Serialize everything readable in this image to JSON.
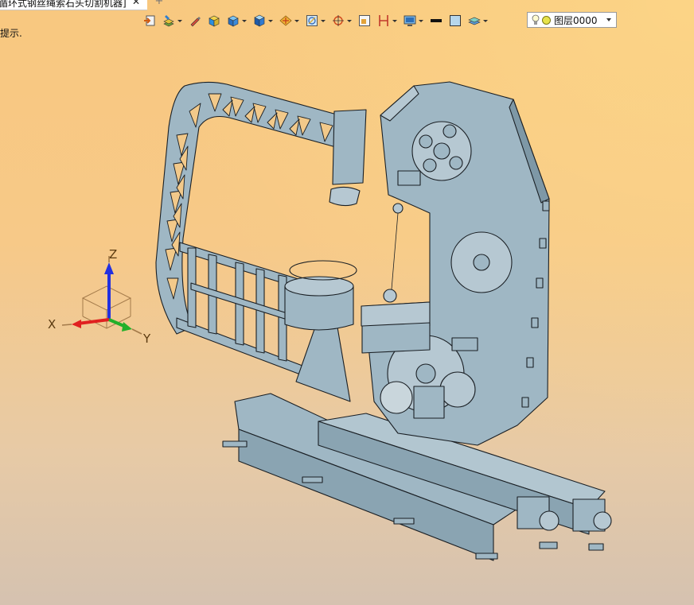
{
  "tab": {
    "title": "循环式钢丝绳索石头切割机器]",
    "close_glyph": "✕",
    "new_glyph": "+"
  },
  "hint": "提示.",
  "toolbar": {
    "items": [
      {
        "name": "import-icon"
      },
      {
        "name": "paint-layers-icon",
        "dropdown": true
      },
      {
        "name": "pen-icon"
      },
      {
        "name": "yellow-box-icon"
      },
      {
        "name": "blue-box-icon",
        "dropdown": true
      },
      {
        "name": "box-view-icon",
        "dropdown": true
      },
      {
        "name": "section-icon",
        "dropdown": true
      },
      {
        "name": "frame-icon",
        "dropdown": true
      },
      {
        "name": "target-icon",
        "dropdown": true
      },
      {
        "name": "single-view-icon"
      },
      {
        "name": "split-view-icon",
        "dropdown": true
      },
      {
        "name": "display-icon",
        "dropdown": true
      },
      {
        "name": "line-color-icon"
      },
      {
        "name": "fill-color-icon"
      },
      {
        "name": "layers-icon",
        "dropdown": true
      }
    ],
    "layer": {
      "label": "图层0000"
    }
  },
  "triad": {
    "x_label": "X",
    "y_label": "Y",
    "z_label": "Z"
  },
  "colors": {
    "model_fill": "#9fb7c4",
    "model_edge": "#1a1f24",
    "axis_x": "#e02020",
    "axis_y": "#22b02a",
    "axis_z": "#2230e0"
  }
}
